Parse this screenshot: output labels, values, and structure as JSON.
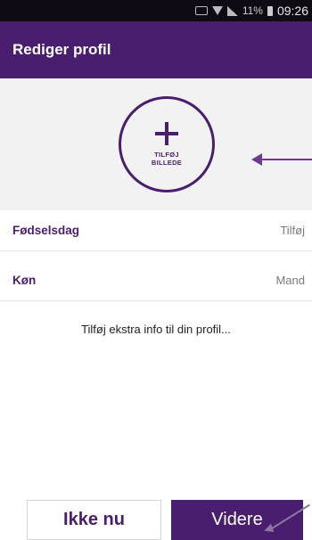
{
  "status_bar": {
    "battery_percent": "11%",
    "time": "09:26",
    "icons": [
      "nfc-icon",
      "wifi-icon",
      "signal-icon",
      "battery-icon"
    ]
  },
  "header": {
    "title": "Rediger profil"
  },
  "photo": {
    "label_line1": "TILFØJ",
    "label_line2": "BILLEDE",
    "icon": "plus-icon"
  },
  "rows": [
    {
      "label": "Fødselsdag",
      "value": "Tilføj"
    },
    {
      "label": "Køn",
      "value": "Mand"
    }
  ],
  "extra_info": "Tilføj ekstra info til din profil...",
  "buttons": {
    "secondary": "Ikke nu",
    "primary": "Videre"
  },
  "colors": {
    "brand": "#4a1e6e",
    "status_bar": "#0e0b14",
    "photo_bg": "#f2f2f2"
  }
}
